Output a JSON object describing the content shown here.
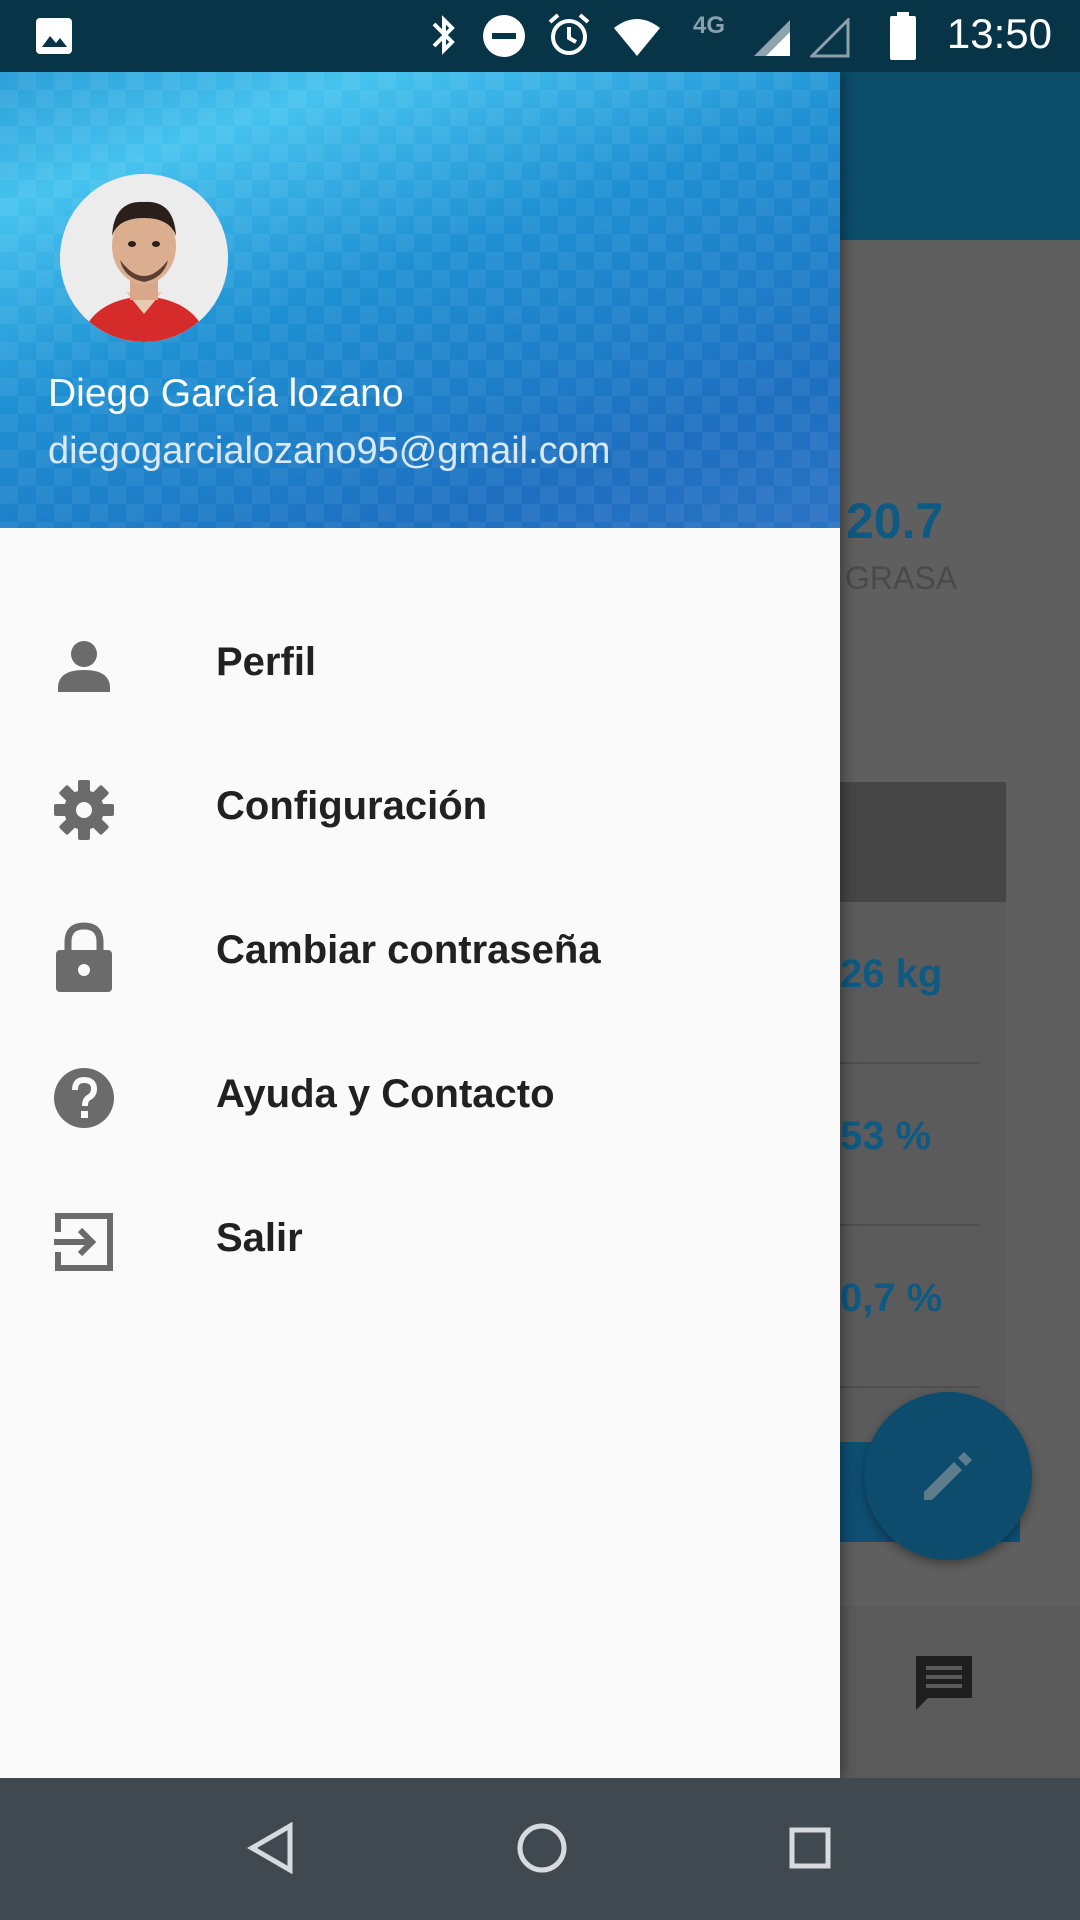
{
  "status_bar": {
    "time": "13:50",
    "network": "4G",
    "icons": [
      "image-icon",
      "bluetooth-icon",
      "do-not-disturb-icon",
      "alarm-icon",
      "wifi-icon",
      "signal-icon",
      "signal-empty-icon",
      "battery-icon"
    ]
  },
  "background_screen": {
    "stat_value": "20.7",
    "stat_label": "GRASA",
    "rows": [
      "26 kg",
      "53 %",
      "0,7 %"
    ]
  },
  "drawer": {
    "header": {
      "name": "Diego García lozano",
      "email": "diegogarcialozano95@gmail.com"
    },
    "menu": [
      {
        "label": "Perfil",
        "icon": "person-icon"
      },
      {
        "label": "Configuración",
        "icon": "settings-gear-icon"
      },
      {
        "label": "Cambiar contraseña",
        "icon": "lock-icon"
      },
      {
        "label": "Ayuda y Contacto",
        "icon": "help-icon"
      },
      {
        "label": "Salir",
        "icon": "exit-icon"
      }
    ]
  },
  "colors": {
    "icon_gray": "#6b6b6b",
    "accent_blue": "#0e5a83",
    "status_bar": "#073447",
    "nav_bar": "#414950"
  }
}
